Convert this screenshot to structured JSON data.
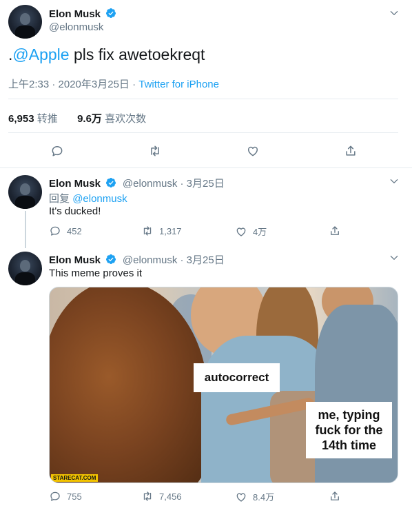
{
  "main_tweet": {
    "display_name": "Elon Musk",
    "handle": "@elonmusk",
    "text_prefix": ".",
    "text_mention": "@Apple",
    "text_rest": " pls fix awetoekreqt",
    "timestamp": "上午2:33 · 2020年3月25日",
    "separator": " · ",
    "source": "Twitter for iPhone",
    "retweets_count": "6,953",
    "retweets_label": "转推",
    "likes_count": "9.6万",
    "likes_label": "喜欢次数"
  },
  "reply_1": {
    "display_name": "Elon Musk",
    "handle_date": "@elonmusk · 3月25日",
    "reply_to_label": "回复",
    "reply_to_handle": "@elonmusk",
    "text": "It's ducked!",
    "reply_count": "452",
    "retweet_count": "1,317",
    "like_count": "4万"
  },
  "reply_2": {
    "display_name": "Elon Musk",
    "handle_date": "@elonmusk · 3月25日",
    "text": "This meme proves it",
    "meme_caption_1": "autocorrect",
    "meme_caption_2": "me, typing fuck for the 14th time",
    "meme_watermark": "STARECAT.COM",
    "reply_count": "755",
    "retweet_count": "7,456",
    "like_count": "8.4万"
  },
  "colors": {
    "accent": "#1da1f2",
    "muted": "#657786",
    "text": "#14171a",
    "divider": "#e6ecf0"
  },
  "icons": [
    "verified-badge-icon",
    "chevron-down-icon",
    "reply-icon",
    "retweet-icon",
    "like-icon",
    "share-icon"
  ]
}
